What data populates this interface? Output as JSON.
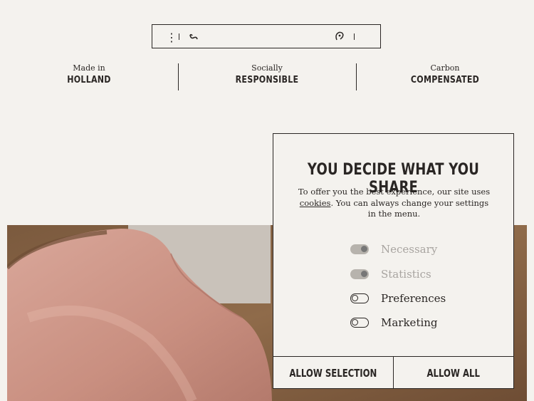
{
  "header": {
    "menu_icon": "vertical-dots-icon",
    "logo_icon": "brand-logo-icon",
    "ear_icon": "ear-icon"
  },
  "features": [
    {
      "small": "Made in",
      "big": "HOLLAND"
    },
    {
      "small": "Socially",
      "big": "RESPONSIBLE"
    },
    {
      "small": "Carbon",
      "big": "COMPENSATED"
    }
  ],
  "cookie": {
    "title": "YOU DECIDE WHAT YOU SHARE",
    "text_before": "To offer you the best experience, our site uses ",
    "link": "cookies",
    "text_after": ". You can always change your settings in the menu.",
    "options": [
      {
        "label": "Necessary",
        "state": "on",
        "disabled": true
      },
      {
        "label": "Statistics",
        "state": "on",
        "disabled": true
      },
      {
        "label": "Preferences",
        "state": "off",
        "disabled": false
      },
      {
        "label": "Marketing",
        "state": "off",
        "disabled": false
      }
    ],
    "allow_selection": "ALLOW SELECTION",
    "allow_all": "ALLOW ALL"
  },
  "colors": {
    "background": "#f4f2ee",
    "ink": "#2a2624",
    "disabled": "#a8a4a0"
  }
}
